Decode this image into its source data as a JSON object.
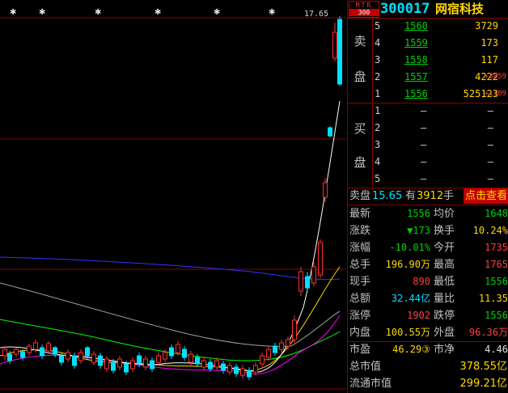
{
  "chart": {
    "price_label": "17.65",
    "colors": {
      "up": "#ff3030",
      "down": "#00e0ff",
      "ma5": "#ffffff",
      "ma10": "#ffd700",
      "ma20": "#ff00ff",
      "ma30": "#00ff00",
      "ma60": "#a0a0a0",
      "ma120": "#3333ff"
    }
  },
  "header": {
    "badge_top": "MTR",
    "badge_bottom": "300",
    "code": "300017",
    "name": "网宿科技"
  },
  "orderbook": {
    "sell_label_1": "卖",
    "sell_label_2": "盘",
    "buy_label_1": "买",
    "buy_label_2": "盘",
    "sell": [
      {
        "level": "5",
        "price": "1560",
        "volume": "3729",
        "change": ""
      },
      {
        "level": "4",
        "price": "1559",
        "volume": "173",
        "change": ""
      },
      {
        "level": "3",
        "price": "1558",
        "volume": "117",
        "change": ""
      },
      {
        "level": "2",
        "price": "1557",
        "volume": "4222",
        "change": "+3859"
      },
      {
        "level": "1",
        "price": "1556",
        "volume": "525123",
        "change": "+1109"
      }
    ],
    "buy": [
      {
        "level": "1",
        "price": "–",
        "volume": "–"
      },
      {
        "level": "2",
        "price": "–",
        "volume": "–"
      },
      {
        "level": "3",
        "price": "–",
        "volume": "–"
      },
      {
        "level": "4",
        "price": "–",
        "volume": "–"
      },
      {
        "level": "5",
        "price": "–",
        "volume": "–"
      }
    ]
  },
  "sellbar": {
    "label": "卖盘",
    "price": "15.65",
    "has": "有",
    "qty": "3912",
    "unit": "手",
    "button": "点击查看"
  },
  "info": [
    {
      "k1": "最新",
      "v1": "1556",
      "c1": "g",
      "k2": "均价",
      "v2": "1648",
      "c2": "g"
    },
    {
      "k1": "涨跌",
      "v1": "▼173",
      "c1": "g",
      "k2": "换手",
      "v2": "10.24%",
      "c2": "y"
    },
    {
      "k1": "涨幅",
      "v1": "-10.01%",
      "c1": "g",
      "k2": "今开",
      "v2": "1735",
      "c2": "r"
    },
    {
      "k1": "总手",
      "v1": "196.90万",
      "c1": "y",
      "k2": "最高",
      "v2": "1765",
      "c2": "r"
    },
    {
      "k1": "现手",
      "v1": "890",
      "c1": "r",
      "k2": "最低",
      "v2": "1556",
      "c2": "g"
    },
    {
      "k1": "总额",
      "v1": "32.44亿",
      "c1": "c",
      "k2": "量比",
      "v2": "11.35",
      "c2": "y"
    },
    {
      "k1": "涨停",
      "v1": "1902",
      "c1": "r",
      "k2": "跌停",
      "v2": "1556",
      "c2": "g"
    },
    {
      "k1": "内盘",
      "v1": "100.55万",
      "c1": "y",
      "k2": "外盘",
      "v2": "96.36万",
      "c2": "r"
    },
    {
      "k1": "市盈",
      "v1": "46.29③",
      "c1": "y",
      "k2": "市净",
      "v2": "4.46",
      "c2": "w"
    }
  ],
  "market_cap": {
    "total_label": "总市值",
    "total_value": "378.55亿",
    "float_label": "流通市值",
    "float_value": "299.21亿"
  }
}
